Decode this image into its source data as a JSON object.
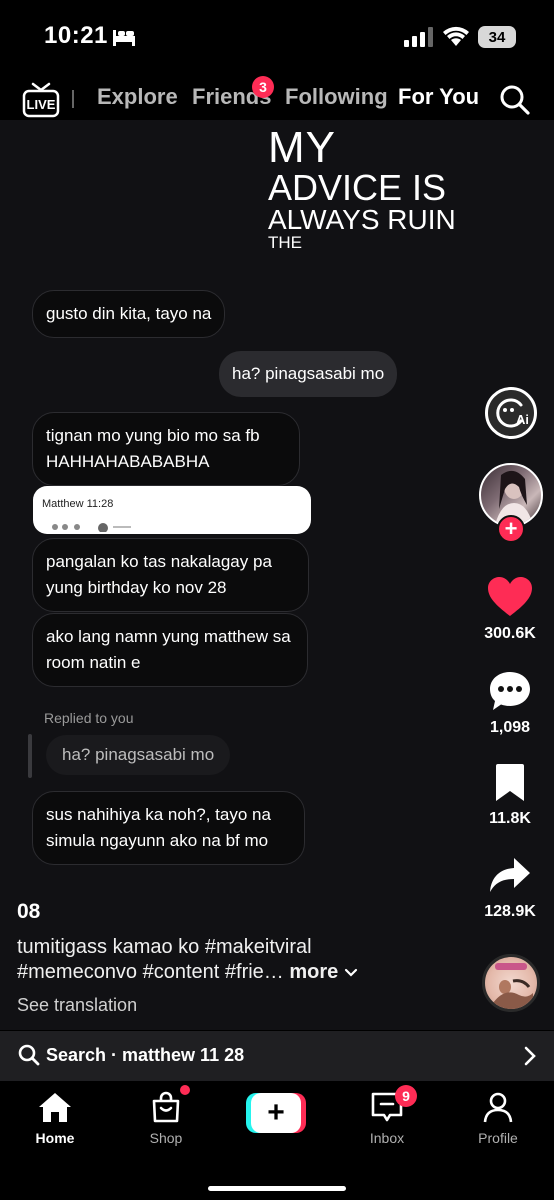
{
  "status_bar": {
    "time": "10:21",
    "battery": "34"
  },
  "top_nav": {
    "tabs": [
      {
        "label": "Explore"
      },
      {
        "label": "Friends",
        "badge": "3"
      },
      {
        "label": "Following"
      },
      {
        "label": "For You",
        "active": true
      }
    ],
    "live_label": "LIVE"
  },
  "video": {
    "overlay_text": {
      "line1": "MY",
      "line2": "ADVICE IS",
      "line3": "ALWAYS RUIN",
      "line4": "THE"
    },
    "messages": [
      {
        "side": "received",
        "text": "gusto din kita, tayo na"
      },
      {
        "side": "sent",
        "text": "ha? pinagsasabi mo"
      },
      {
        "side": "received",
        "text": "tignan mo yung bio mo sa fb HAHHAHABABABHA"
      },
      {
        "side": "received",
        "text": "pangalan ko tas nakalagay pa yung birthday ko nov 28"
      },
      {
        "side": "received",
        "text": "ako lang namn yung matthew sa room natin e"
      },
      {
        "side": "received",
        "text": "sus nahihiya ka noh?, tayo na simula ngayunn ako na bf mo"
      }
    ],
    "screenshot_card": {
      "name": "Matthew 11:28"
    },
    "replied_label": "Replied to you",
    "reply_quote": "ha? pinagsasabi mo"
  },
  "rail": {
    "likes": "300.6K",
    "comments": "1,098",
    "saves": "11.8K",
    "shares": "128.9K",
    "ai_label": "Ai"
  },
  "description": {
    "author": "08",
    "caption": "tumitigass kamao ko #makeitviral #memeconvo #content #frie…",
    "more": "more",
    "see_translation": "See translation"
  },
  "search_strip": {
    "label": "Search · matthew 11 28"
  },
  "bottom_nav": {
    "home": "Home",
    "shop": "Shop",
    "inbox": "Inbox",
    "inbox_badge": "9",
    "profile": "Profile"
  },
  "colors": {
    "accent": "#fe2c55",
    "cyan": "#25f4ee",
    "background": "#000000"
  }
}
